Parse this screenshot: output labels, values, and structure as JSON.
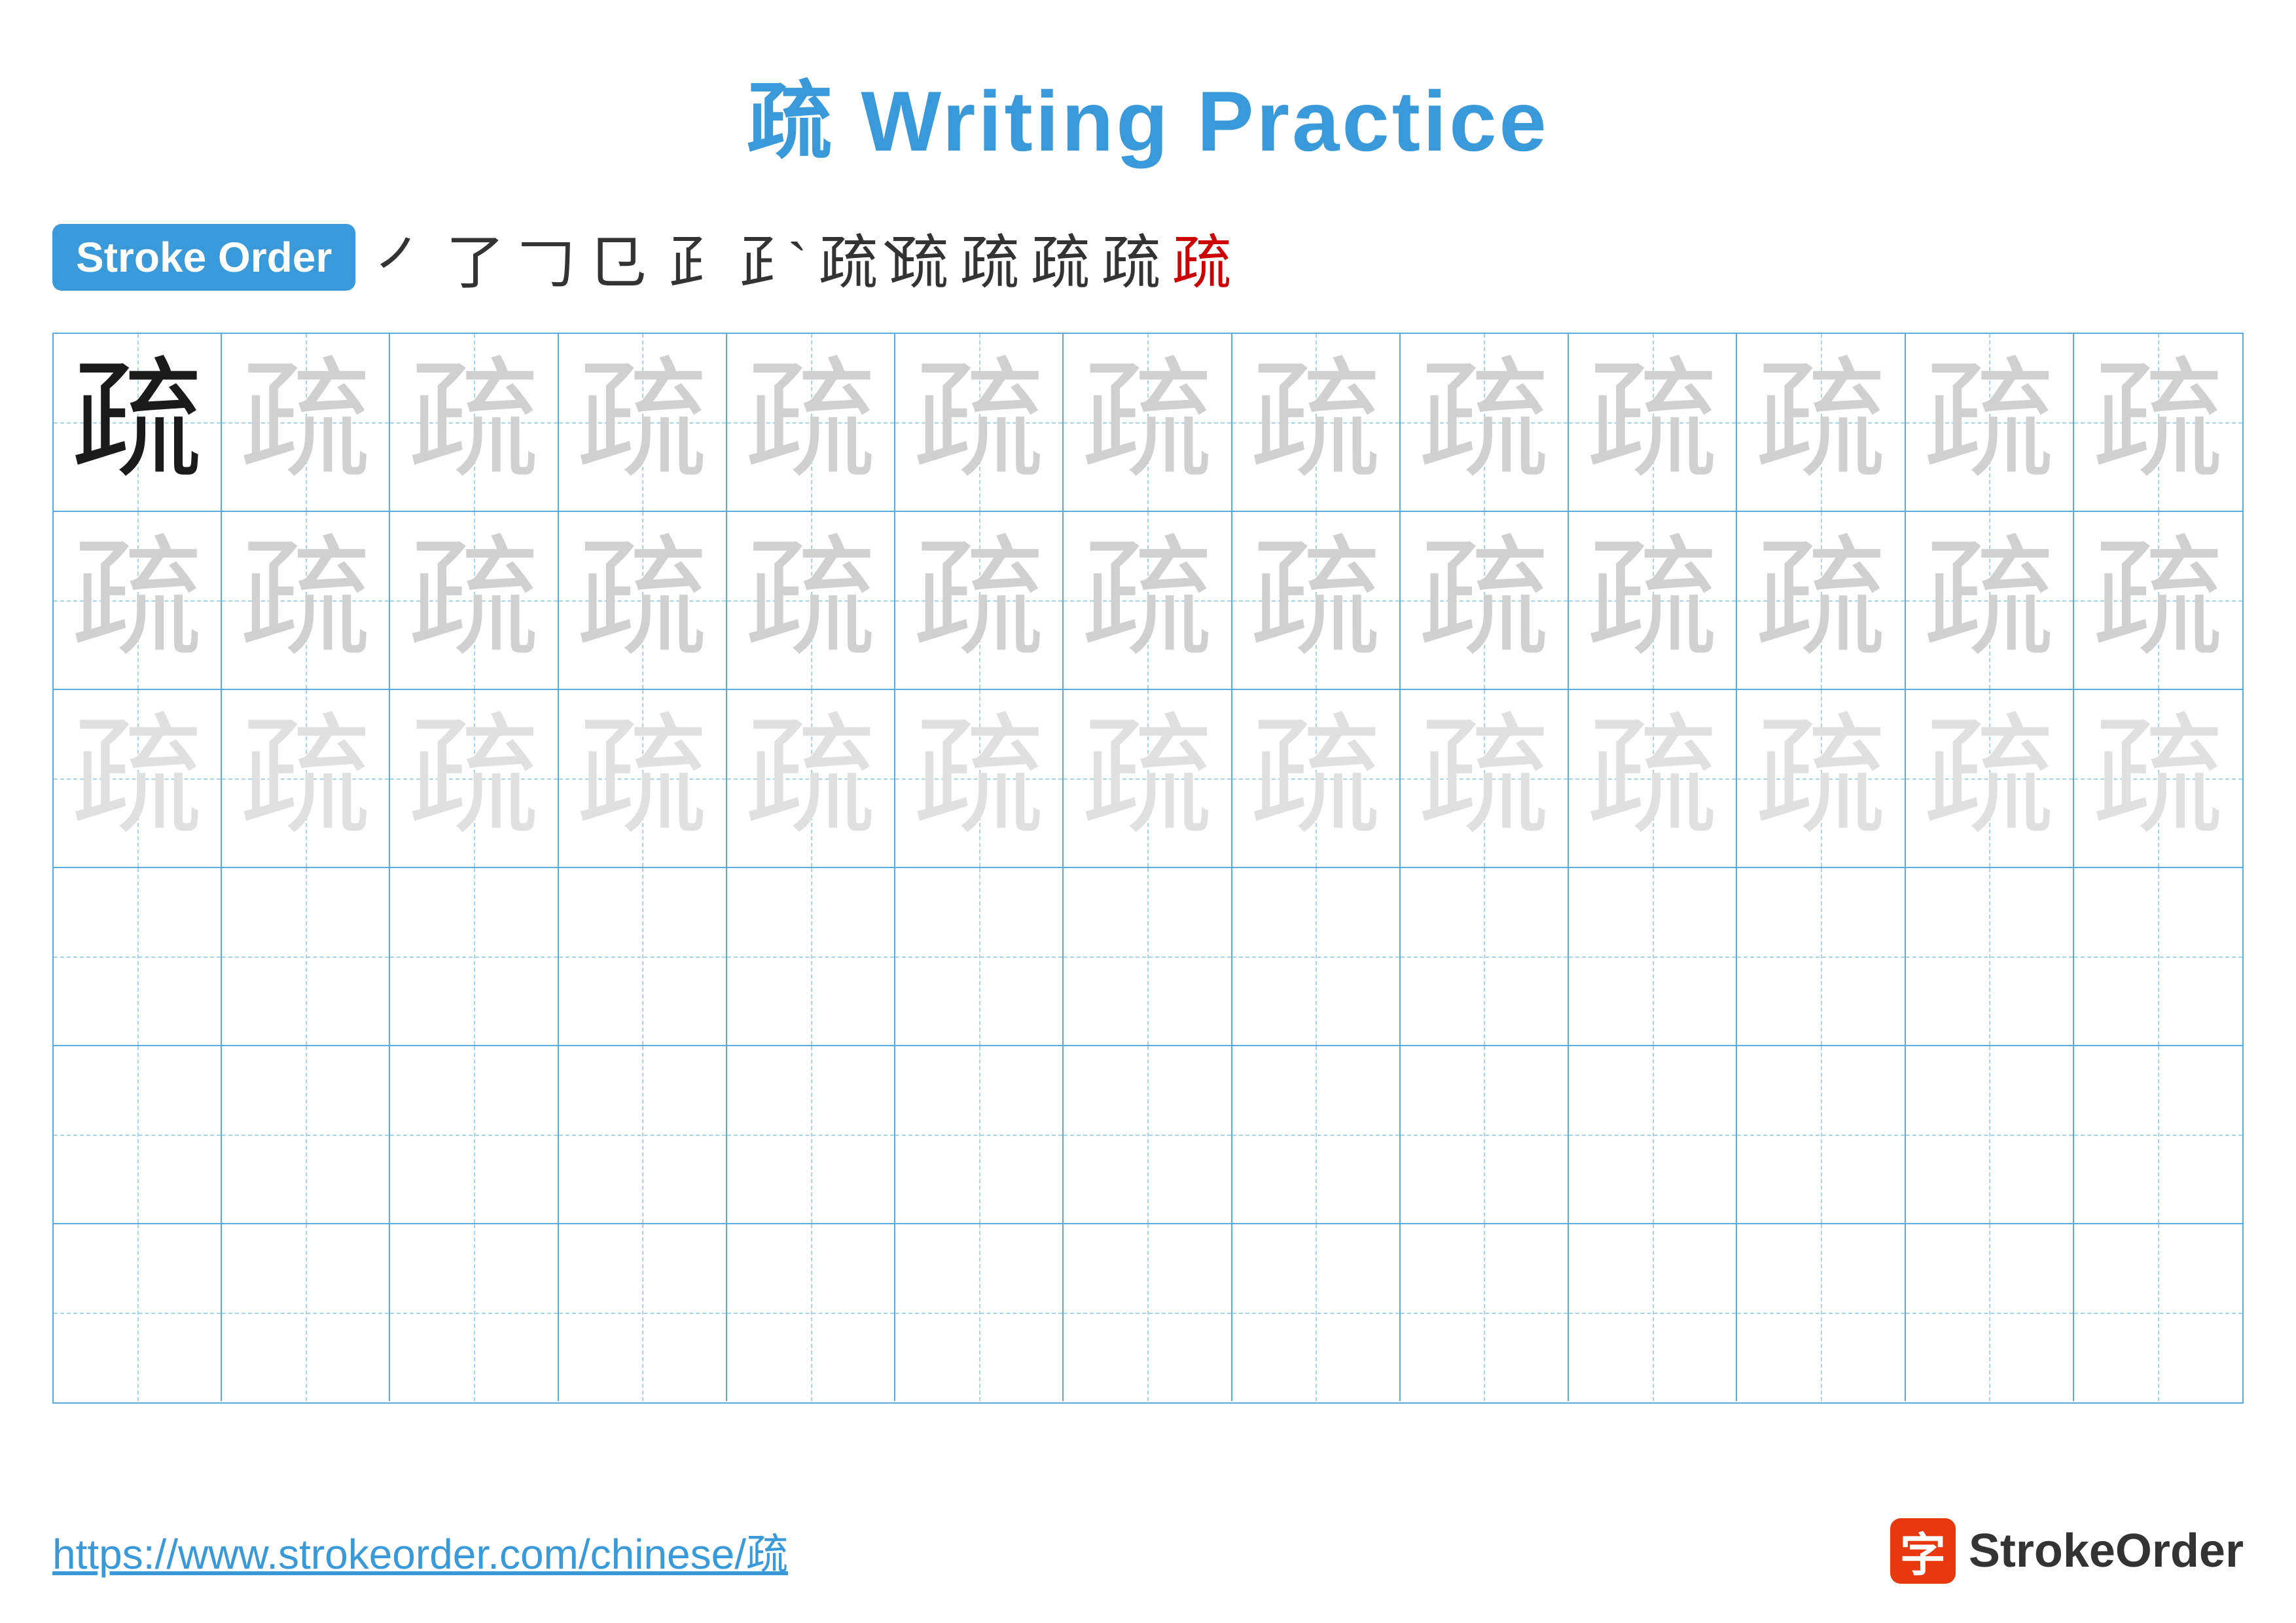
{
  "title": "疏 Writing Practice",
  "stroke_order_badge": "Stroke Order",
  "strokes": [
    "㇒",
    "了",
    "𠃌",
    "𠃊",
    "𠄌",
    "疋",
    "疋`",
    "疋`",
    "疏",
    "疏",
    "疏",
    "疏"
  ],
  "main_char": "疏",
  "grid_rows": 6,
  "grid_cols": 13,
  "footer_url": "https://www.strokeorder.com/chinese/疏",
  "footer_brand": "StrokeOrder",
  "brand_icon_char": "字",
  "char_opacity_row1": "solid",
  "char_opacity_row2": "light",
  "char_opacity_row3": "lighter",
  "colors": {
    "accent": "#3a9ad9",
    "red": "#cc0000",
    "border": "#5aabdd",
    "dashed": "#a8d4f0",
    "solid_char": "#1a1a1a",
    "light_char": "#d0d0d0",
    "lighter_char": "#e0e0e0"
  }
}
